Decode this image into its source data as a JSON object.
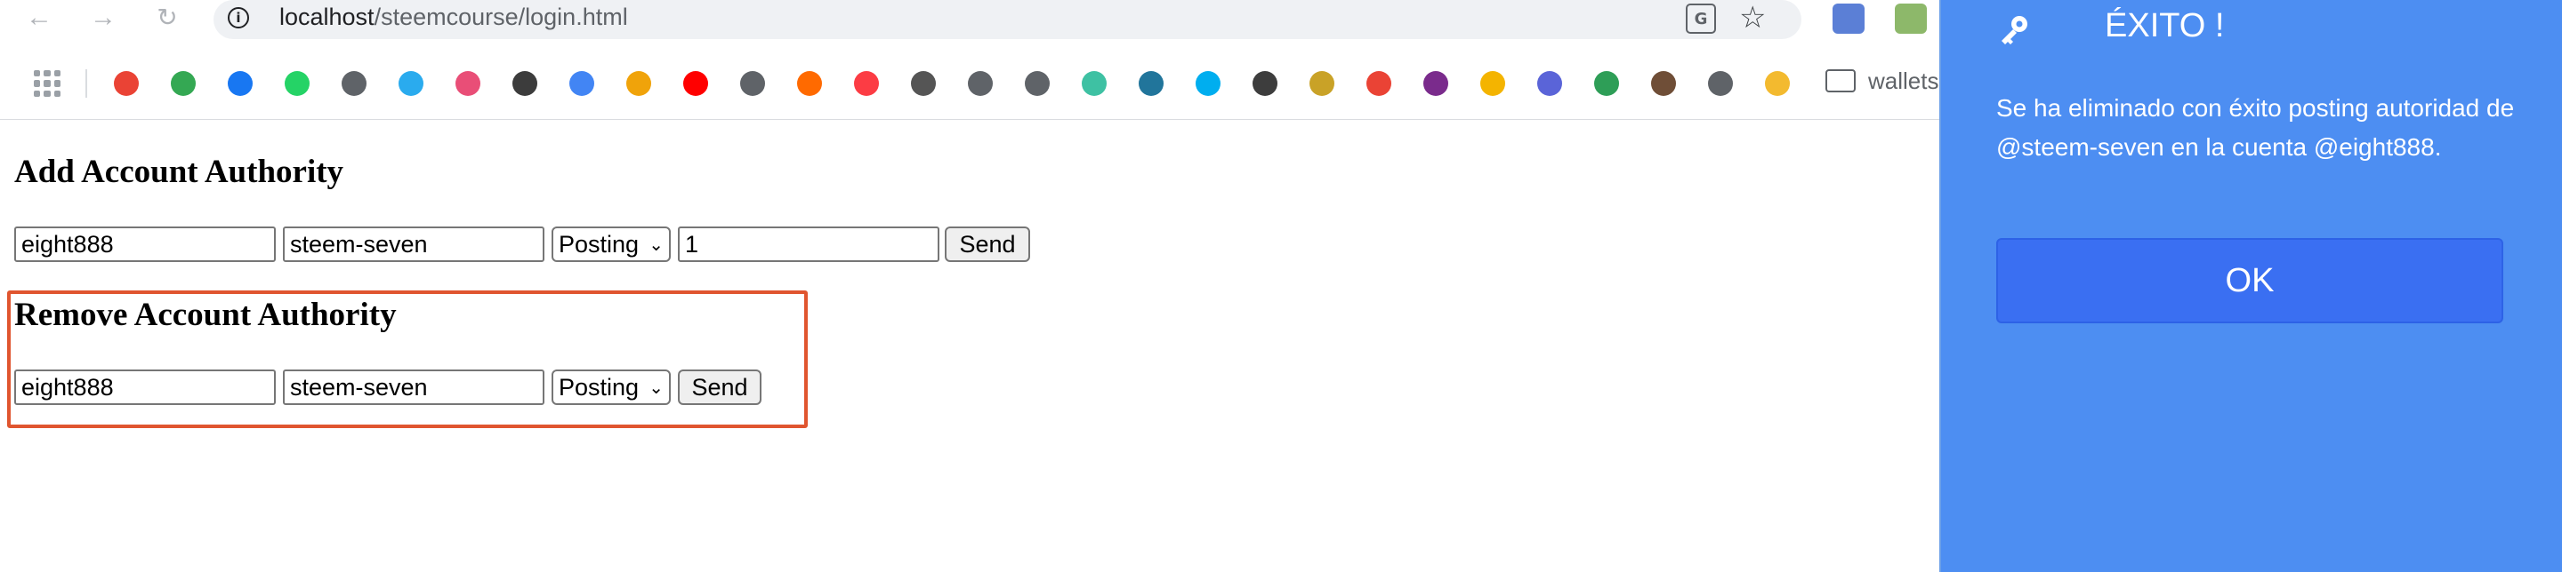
{
  "browser": {
    "url_host": "localhost",
    "url_path": "/steemcourse/login.html",
    "info_glyph": "i",
    "translate_glyph": "G",
    "bookmarks_folder_label": "wallets",
    "bookmark_colors": [
      "#ea4335",
      "#34a853",
      "#1877f2",
      "#25d366",
      "#5f6368",
      "#2aabee",
      "#e94e77",
      "#3c3c3c",
      "#4285f4",
      "#f0a30a",
      "#ff0000",
      "#5f6368",
      "#ff6a00",
      "#fc3c44",
      "#555555",
      "#5f6368",
      "#5f6368",
      "#3ec1a3",
      "#21759b",
      "#00aeef",
      "#3d3d3d",
      "#c9a227",
      "#ea4335",
      "#7a2b8c",
      "#f4b400",
      "#5a64d8",
      "#2e9e57",
      "#6f4e37",
      "#5f6368",
      "#f3ba2f"
    ],
    "extension_colors": [
      "#5b7fd6",
      "#8db86a"
    ]
  },
  "add_section": {
    "title": "Add Account Authority",
    "account_value": "eight888",
    "authority_account_value": "steem-seven",
    "role_value": "Posting",
    "weight_value": "1",
    "send_label": "Send"
  },
  "remove_section": {
    "title": "Remove Account Authority",
    "account_value": "eight888",
    "authority_account_value": "steem-seven",
    "role_value": "Posting",
    "send_label": "Send"
  },
  "notification": {
    "title": "ÉXITO !",
    "message": "Se ha eliminado con éxito posting autoridad de @steem-seven en la cuenta @eight888.",
    "ok_label": "OK",
    "background_color": "#4d8ef2",
    "button_color": "#3a6ff2"
  },
  "icons": {
    "back": "arrow-left-icon",
    "forward": "arrow-right-icon",
    "reload": "reload-icon",
    "info": "info-icon",
    "translate": "translate-icon",
    "bookmark": "star-icon",
    "apps": "apps-grid-icon",
    "folder": "folder-icon",
    "panel": "key-icon"
  },
  "highlight_color": "#e0552f"
}
